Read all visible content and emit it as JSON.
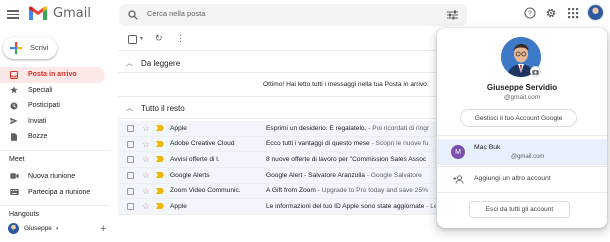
{
  "app": {
    "name": "Gmail"
  },
  "search": {
    "placeholder": "Cerca nella posta"
  },
  "compose": {
    "label": "Scrivi"
  },
  "nav": [
    {
      "label": "Posta in arrivo",
      "icon": "inbox-icon",
      "active": true
    },
    {
      "label": "Speciali",
      "icon": "star-icon"
    },
    {
      "label": "Posticipati",
      "icon": "clock-icon"
    },
    {
      "label": "Inviati",
      "icon": "send-icon"
    },
    {
      "label": "Bozze",
      "icon": "draft-icon"
    }
  ],
  "meet": {
    "title": "Meet",
    "items": [
      {
        "label": "Nuova riunione",
        "icon": "video-icon"
      },
      {
        "label": "Partecipa a riunione",
        "icon": "keyboard-icon"
      }
    ]
  },
  "hangouts": {
    "title": "Hangouts",
    "user": "Giuseppe"
  },
  "sections": {
    "first": "Da leggere",
    "first_empty": "Ottimo! Hai letto tutti i messaggi nella tua Posta in arrivo.",
    "second": "Tutto il resto"
  },
  "emails": [
    {
      "sender": "Apple",
      "subject": "Esprimi un desiderio. È regalatelo.",
      "snippet": " - Poi ricordati di ringr"
    },
    {
      "sender": "Adobe Creative Cloud",
      "subject": "Ecco tutti i vantaggi di questo mese",
      "snippet": " - Scopri le nuove fu"
    },
    {
      "sender": "Avvisi offerte di l.",
      "subject": "8 nuove offerte di lavoro per \"Commission Sales Assoc",
      "snippet": ""
    },
    {
      "sender": "Google Alerts",
      "subject": "Google Alert - Salvatore Aranzulla",
      "snippet": " - Google Salvatore"
    },
    {
      "sender": "Zoom Video Communic.",
      "subject": "A Gift from Zoom",
      "snippet": " - Upgrade to Pro today and save 25%"
    },
    {
      "sender": "Apple",
      "subject": "Le informazioni del tuo ID Apple sono state aggiornate",
      "snippet": " - Le informazioni del tuo ID"
    }
  ],
  "account": {
    "name": "Giuseppe Servidio",
    "email": "@gmail.com",
    "manage_label": "Gestisci il tuo Account Google",
    "other": {
      "initial": "M",
      "name": "Mac Buk",
      "email": "@gmail.com"
    },
    "add_label": "Aggiungi un altro account",
    "logout_label": "Esci da tutti gli account"
  },
  "colors": {
    "active_bg": "#fce8e6",
    "active_text": "#d93025",
    "important": "#f2b600",
    "other_account_bg": "#e8f0fe"
  }
}
